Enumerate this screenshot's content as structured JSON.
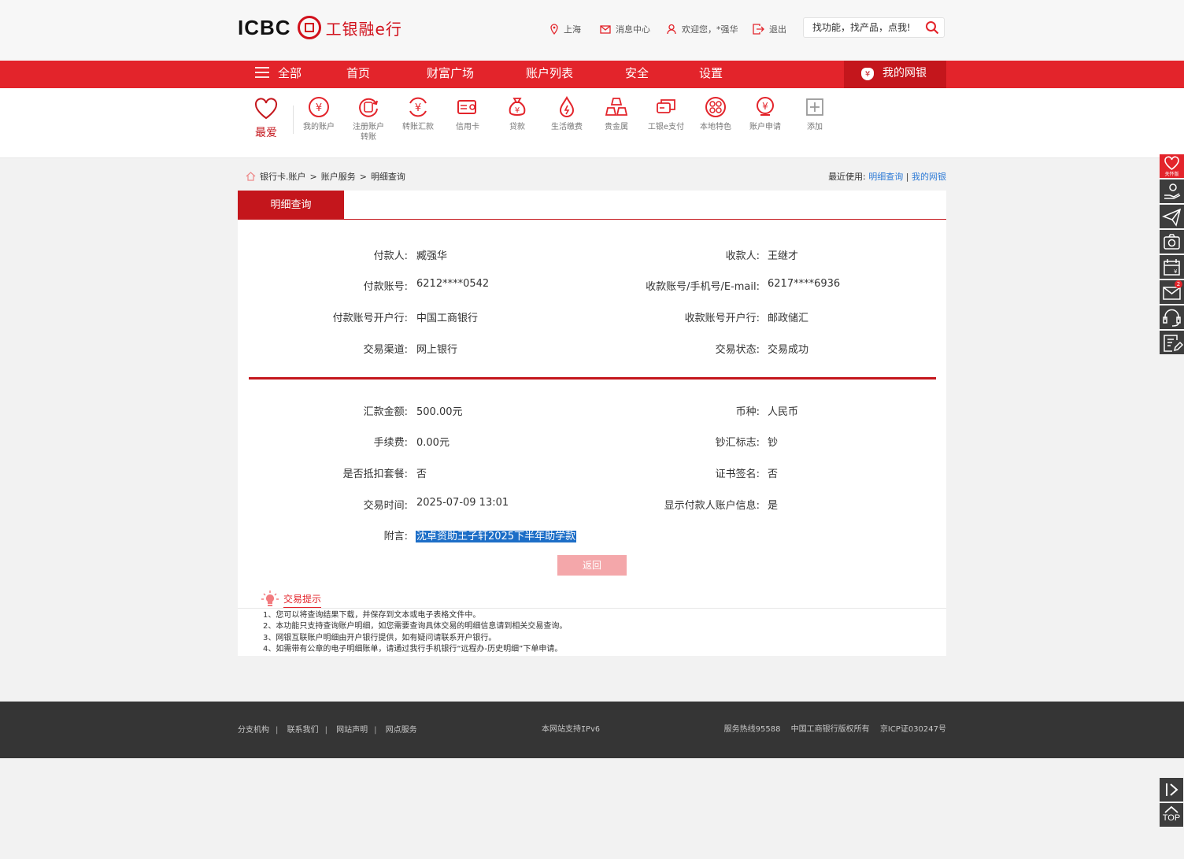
{
  "header": {
    "logo_text": "ICBC",
    "logo_cn": "工银融e行",
    "location": "上海",
    "messages": "消息中心",
    "welcome": "欢迎您，*强华",
    "logout": "退出",
    "search_placeholder": "找功能，找产品，点我!"
  },
  "nav": {
    "all": "全部",
    "items": [
      "首页",
      "财富广场",
      "账户列表",
      "安全",
      "设置"
    ],
    "mybank": "我的网银"
  },
  "quick": {
    "favorite": "最爱",
    "items": [
      {
        "label": "我的账户",
        "icon": "yuan-circle-icon"
      },
      {
        "label": "注册账户转账",
        "icon": "transfer-yuan-icon"
      },
      {
        "label": "转账汇款",
        "icon": "remit-icon"
      },
      {
        "label": "信用卡",
        "icon": "credit-card-icon"
      },
      {
        "label": "贷款",
        "icon": "money-bag-icon"
      },
      {
        "label": "生活缴费",
        "icon": "droplet-icon"
      },
      {
        "label": "贵金属",
        "icon": "gold-bars-icon"
      },
      {
        "label": "工银e支付",
        "icon": "e-pay-icon"
      },
      {
        "label": "本地特色",
        "icon": "local-dots-icon"
      },
      {
        "label": "账户申请",
        "icon": "account-apply-icon"
      },
      {
        "label": "添加",
        "icon": "add-icon"
      }
    ]
  },
  "breadcrumb": {
    "items": [
      "银行卡.账户",
      "账户服务",
      "明细查询"
    ],
    "sep": ">"
  },
  "recent": {
    "label": "最近使用:",
    "link1": "明细查询",
    "sep": "|",
    "link2": "我的网银"
  },
  "detail": {
    "tab": "明细查询",
    "payer_label": "付款人:",
    "payer": "臧强华",
    "payee_label": "收款人:",
    "payee": "王继才",
    "payer_acct_label": "付款账号:",
    "payer_acct": "6212****0542",
    "payee_acct_label": "收款账号/手机号/E-mail:",
    "payee_acct": "6217****6936",
    "payer_bank_label": "付款账号开户行:",
    "payer_bank": "中国工商银行",
    "payee_bank_label": "收款账号开户行:",
    "payee_bank": "邮政储汇",
    "channel_label": "交易渠道:",
    "channel": "网上银行",
    "status_label": "交易状态:",
    "status": "交易成功",
    "amount_label": "汇款金额:",
    "amount": "500.00元",
    "currency_label": "币种:",
    "currency": "人民币",
    "fee_label": "手续费:",
    "fee": "0.00元",
    "cash_label": "钞汇标志:",
    "cash": "钞",
    "package_label": "是否抵扣套餐:",
    "package": "否",
    "cert_label": "证书签名:",
    "cert": "否",
    "time_label": "交易时间:",
    "time": "2025-07-09 13:01",
    "show_payer_label": "显示付款人账户信息:",
    "show_payer": "是",
    "note_label": "附言:",
    "note": "沈卓资助王子轩2025下半年助学款",
    "back": "返回"
  },
  "tips": {
    "title": "交易提示",
    "items": [
      "1、您可以将查询结果下载，并保存到文本或电子表格文件中。",
      "2、本功能只支持查询账户明细，如您需要查询具体交易的明细信息请到相关交易查询。",
      "3、网银互联账户明细由开户银行提供，如有疑问请联系开户银行。",
      "4、如需带有公章的电子明细账单，请通过我行手机银行“远程办-历史明细”下单申请。"
    ]
  },
  "footer": {
    "links": [
      "分支机构",
      "联系我们",
      "网站声明",
      "网点服务"
    ],
    "ipv6": "本网站支持IPv6",
    "hotline": "服务热线95588",
    "copyright": "中国工商银行版权所有",
    "icp": "京ICP证030247号"
  },
  "side": {
    "care_label": "关怀版",
    "msg_count": "2",
    "top": "TOP"
  },
  "colors": {
    "brand_red": "#e3242b",
    "dark_red": "#c4161c",
    "link_blue": "#2e7bd6",
    "footer_bg": "#353535"
  }
}
